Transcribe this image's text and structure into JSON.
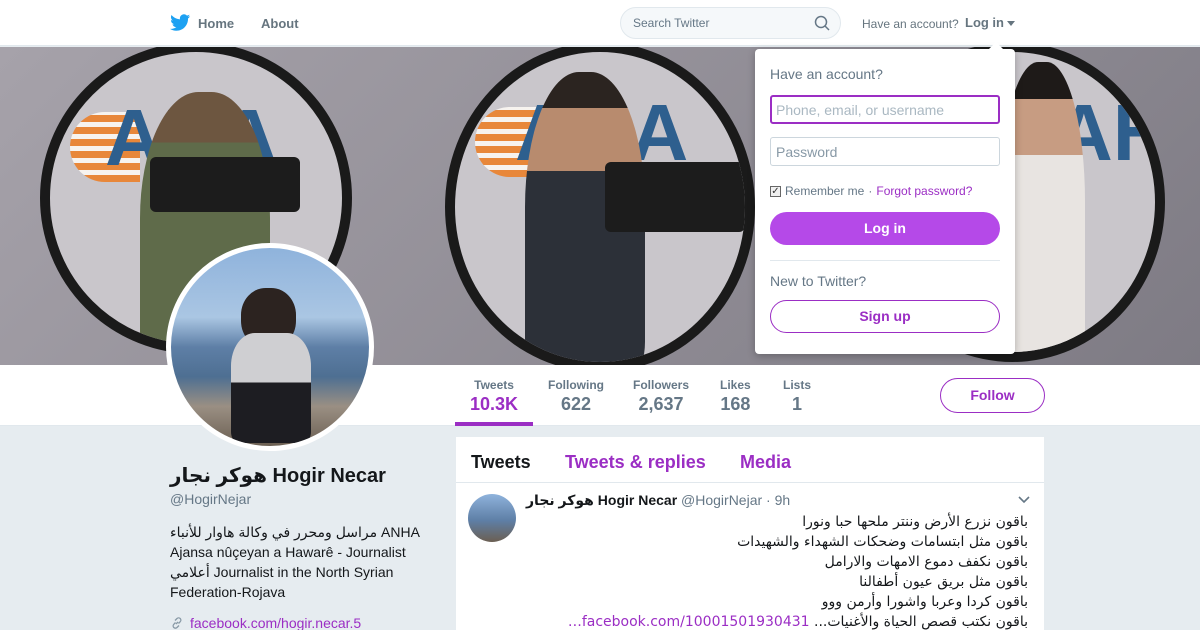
{
  "nav": {
    "home_label": "Home",
    "about_label": "About",
    "search_placeholder": "Search Twitter",
    "have_account": "Have an account?",
    "login_label": "Log in"
  },
  "stats": {
    "tweets": {
      "label": "Tweets",
      "value": "10.3K"
    },
    "following": {
      "label": "Following",
      "value": "622"
    },
    "followers": {
      "label": "Followers",
      "value": "2,637"
    },
    "likes": {
      "label": "Likes",
      "value": "168"
    },
    "lists": {
      "label": "Lists",
      "value": "1"
    },
    "follow_label": "Follow"
  },
  "profile": {
    "name": "هوكر نجار Hogir Necar",
    "handle": "@HogirNejar",
    "bio": "مراسل ومحرر في وكالة هاوار للأنباء ANHA Ajansa nûçeyan a Hawarê - Journalist أعلامي Journalist in the North Syrian Federation-Rojava",
    "link": "facebook.com/hogir.necar.5"
  },
  "banner": {
    "logo_text": "AHA"
  },
  "timeline": {
    "tabs": [
      "Tweets",
      "Tweets & replies",
      "Media"
    ],
    "tweet": {
      "name": "هوكر نجار Hogir Necar",
      "handle": "@HogirNejar",
      "time": "· 9h",
      "lines": [
        "باقون نزرع الأرض وننتر ملحها حبا ونورا",
        "باقون مثل ابتسامات وضحكات الشهداء والشهيدات",
        "باقون نكفف دموع الامهات والارامل",
        "باقون مثل بريق عيون أطفالنا",
        "باقون كردا وعربا واشورا وأرمن ووو",
        "باقون نكتب قصص الحياة والأغنيات..."
      ],
      "link": "facebook.com/10001501930431…"
    }
  },
  "login_dropdown": {
    "title": "Have an account?",
    "username_placeholder": "Phone, email, or username",
    "password_placeholder": "Password",
    "remember_label": "Remember me",
    "separator": "·",
    "forgot_label": "Forgot password?",
    "login_button": "Log in",
    "new_label": "New to Twitter?",
    "signup_button": "Sign up"
  },
  "colors": {
    "accent": "#9b2ec4",
    "login_button": "#b549e8",
    "background": "#e6ecf0"
  }
}
